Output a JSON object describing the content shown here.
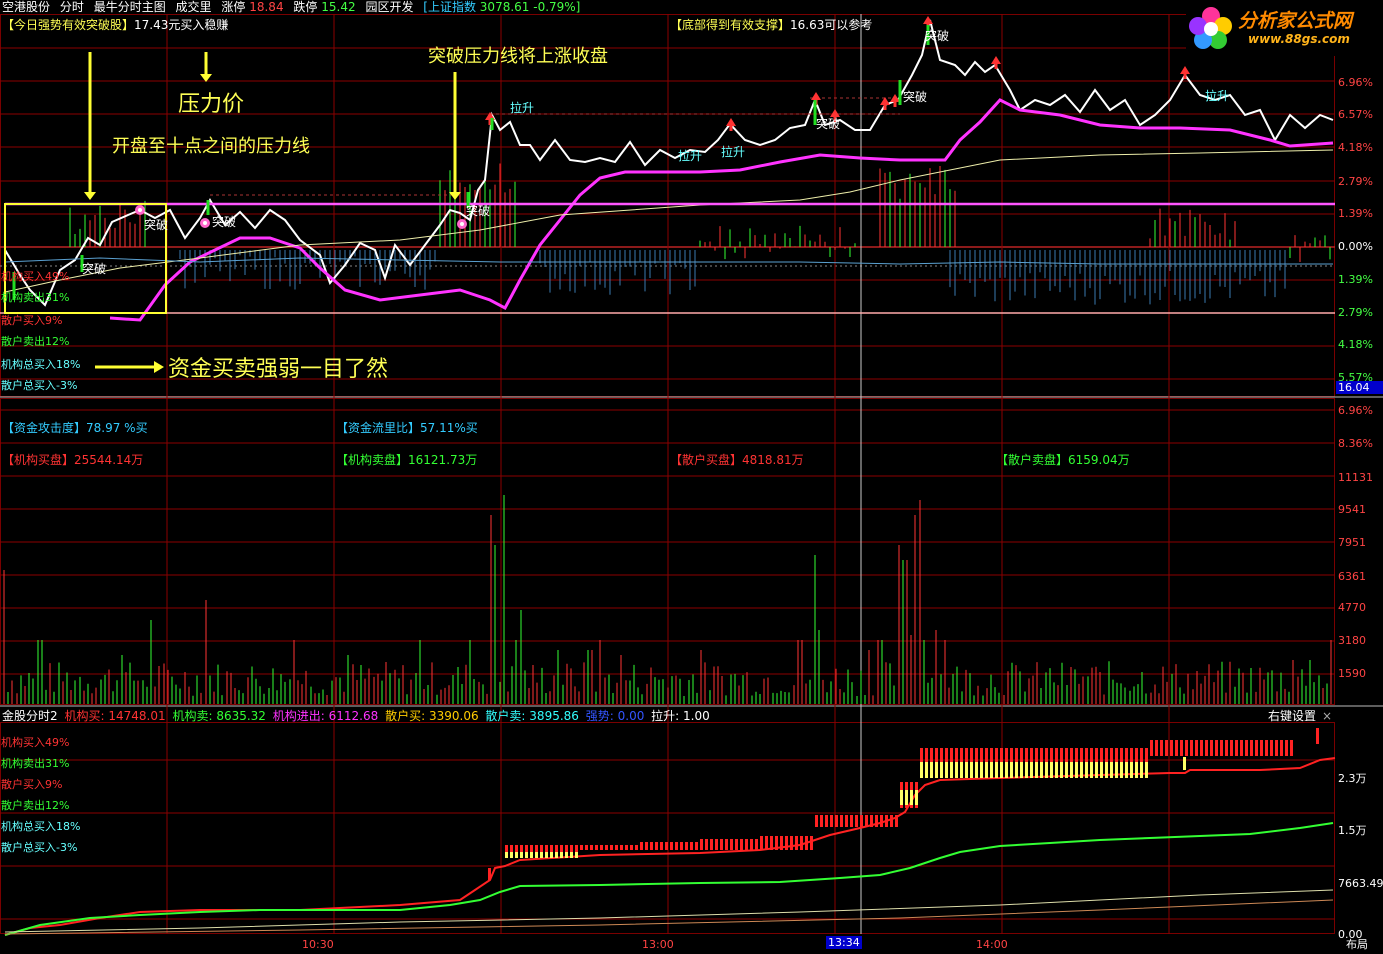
{
  "header": {
    "stock_name": "空港股份",
    "view_mode": "分时",
    "indicator_name": "最牛分时主图",
    "volume_label": "成交里",
    "limit_up_label": "涨停",
    "limit_up_value": "18.84",
    "limit_down_label": "跌停",
    "limit_down_value": "15.42",
    "sector": "园区开发",
    "index_name": "[上证指数",
    "index_value": "3078.61 -0.79%]"
  },
  "logo": {
    "brand": "分析家公式网",
    "url": "www.88gs.com"
  },
  "signals": {
    "left_tag": "【今日强势有效突破股】",
    "left_text": "17.43元买入稳赚",
    "right_tag": "【底部得到有效支撑】",
    "right_text": "16.63可以参考"
  },
  "annotations": {
    "pressure_price": "压力价",
    "pressure_line": "开盘至十点之间的压力线",
    "breakthrough": "突破压力线将上涨收盘",
    "funds_summary": "资金买卖强弱一目了然"
  },
  "chart_marks": {
    "tupo": "突破",
    "lasheng": "拉升"
  },
  "upper_legend": [
    {
      "label": "机构买入49%",
      "color": "#ff3333"
    },
    {
      "label": "机构卖出31%",
      "color": "#33ff33"
    },
    {
      "label": "散户买入9%",
      "color": "#ff3333"
    },
    {
      "label": "散户卖出12%",
      "color": "#33ff33"
    },
    {
      "label": "机构总买入18%",
      "color": "#66ffff"
    },
    {
      "label": "散户总买入-3%",
      "color": "#66ffff"
    }
  ],
  "price_axis": [
    "6.96%",
    "6.57%",
    "4.18%",
    "2.79%",
    "1.39%",
    "0.00%",
    "1.39%",
    "2.79%",
    "4.18%",
    "5.57%"
  ],
  "price_axis_colors": [
    "#ff4444",
    "#ff4444",
    "#ff4444",
    "#ff4444",
    "#ff4444",
    "#ffffff",
    "#44ff44",
    "#44ff44",
    "#44ff44",
    "#44ff44"
  ],
  "crosshair_price": "16.04",
  "mid_axis": [
    "6.96%",
    "8.36%"
  ],
  "funds_stats": {
    "attack_label": "【资金攻击度】",
    "attack_value": "78.97 %买",
    "flow_label": "【资金流里比】",
    "flow_value": "57.11%买",
    "inst_buy_label": "【机构买盘】",
    "inst_buy_value": "25544.14万",
    "inst_sell_label": "【机构卖盘】",
    "inst_sell_value": "16121.73万",
    "retail_buy_label": "【散户买盘】",
    "retail_buy_value": "4818.81万",
    "retail_sell_label": "【散户卖盘】",
    "retail_sell_value": "6159.04万"
  },
  "volume_axis": [
    "11131",
    "9541",
    "7951",
    "6361",
    "4770",
    "3180",
    "1590"
  ],
  "bottom_header": {
    "indicator": "金股分时2",
    "inst_buy_label": "机构买:",
    "inst_buy_value": "14748.01",
    "inst_sell_label": "机构卖:",
    "inst_sell_value": "8635.32",
    "inst_net_label": "机构进出:",
    "inst_net_value": "6112.68",
    "retail_buy_label": "散户买:",
    "retail_buy_value": "3390.06",
    "retail_sell_label": "散户卖:",
    "retail_sell_value": "3895.86",
    "strong_label": "强势:",
    "strong_value": "0.00",
    "pull_label": "拉升:",
    "pull_value": "1.00",
    "settings": "右键设置",
    "close": "×"
  },
  "lower_legend": [
    {
      "label": "机构买入49%",
      "color": "#ff3333"
    },
    {
      "label": "机构卖出31%",
      "color": "#33ff33"
    },
    {
      "label": "散户买入9%",
      "color": "#ff3333"
    },
    {
      "label": "散户卖出12%",
      "color": "#33ff33"
    },
    {
      "label": "机构总买入18%",
      "color": "#66ffff"
    },
    {
      "label": "散户总买入-3%",
      "color": "#66ffff"
    }
  ],
  "lower_axis": [
    "2.3万",
    "1.5万",
    "7663.49",
    "0.00"
  ],
  "time_axis": [
    "10:30",
    "13:00",
    "14:00"
  ],
  "crosshair_time": "13:34",
  "layout_button": "布局"
}
